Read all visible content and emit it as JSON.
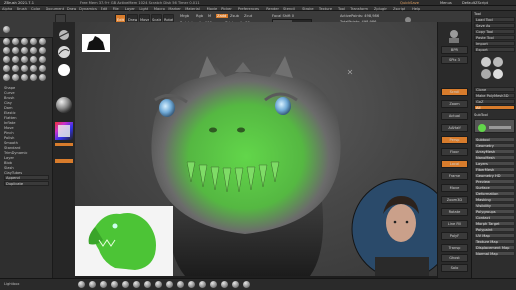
{
  "titlebar": {
    "app_title": "ZBrush 2021.7.1",
    "status_text": "Free Mem 37.9+ GB  ActiveMem 1024  Scratch Disk 56  Timer 0.011",
    "quick_save": "QuickSave",
    "menus_label": "Menus",
    "script_label": "DefaultZScript"
  },
  "menubar": {
    "items": [
      "Alpha",
      "Brush",
      "Color",
      "Document",
      "Draw",
      "Dynamics",
      "Edit",
      "File",
      "Layer",
      "Light",
      "Macro",
      "Marker",
      "Material",
      "Movie",
      "Picker",
      "Preferences",
      "Render",
      "Stencil",
      "Stroke",
      "Texture",
      "Tool",
      "Transform",
      "Zplugin",
      "Zscript",
      "Help"
    ]
  },
  "topshelf": {
    "buttons": [
      "Edit",
      "Draw",
      "Move",
      "Scale",
      "Rotate"
    ],
    "tabs": [
      "Gizmo 3D",
      "Sculpt Mode"
    ],
    "mrgb": "Mrgb",
    "rgb": "Rgb",
    "m": "M",
    "zadd": "Zadd",
    "zsub": "Zsub",
    "zcut": "Zcut",
    "focal_shift_label": "Focal Shift",
    "focal_shift_value": "0",
    "draw_size_label": "Draw Size",
    "draw_size_value": "64",
    "dynamic": "Dynamic",
    "z_intensity_label": "Z Intensity",
    "z_intensity_value": "25",
    "rgb_intensity_label": "Rgb Intensity",
    "rgb_intensity_value": "100",
    "active_points": "ActivePoints: 498,986",
    "total_points": "TotalPoints: 498,986"
  },
  "lefttray": {
    "list": [
      "Shape",
      "Curve",
      "Brush",
      "Clay",
      "Dam",
      "Elastic",
      "Flatten",
      "Inflate",
      "Move",
      "Pinch",
      "Polish",
      "Smooth",
      "Standard",
      "TrimDynamic",
      "Layer",
      "Blob",
      "Slash",
      "ClayTubes",
      "ClayBuildup"
    ],
    "buttons": [
      "Append",
      "Duplicate"
    ]
  },
  "righttray": {
    "header": "Tool",
    "rows": [
      "Load Tool",
      "Save As",
      "Copy Tool",
      "Paste Tool",
      "Import",
      "Export",
      "Clone",
      "Make PolyMesh3D",
      "GoZ",
      "All",
      "Visible",
      "R",
      "Lightbox > Tools"
    ],
    "subtool_header": "SubTool",
    "sections": [
      "Subtool",
      "Geometry",
      "ArrayMesh",
      "NanoMesh",
      "Layers",
      "FiberMesh",
      "Geometry HD",
      "Preview",
      "Surface",
      "Deformation",
      "Masking",
      "Visibility",
      "Polygroups",
      "Contact",
      "Morph Target",
      "Polypaint",
      "UV Map",
      "Texture Map",
      "Displacement Map",
      "Normal Map"
    ]
  },
  "rightshelf": {
    "buttons": [
      "BPR",
      "SPix 3",
      "Scroll",
      "Zoom",
      "Actual",
      "AAHalf",
      "Persp",
      "Floor",
      "Local",
      "Frame",
      "Move",
      "Zoom3D",
      "Rotate",
      "Line Fill",
      "PolyF",
      "Transp",
      "Ghost",
      "Solo",
      "Xpose"
    ]
  },
  "bottomshelf": {
    "brushes": [
      "Standard",
      "ClayBuildup",
      "Move",
      "DamStandard",
      "hPolish",
      "Inflate",
      "Pinch",
      "TrimDynamic",
      "CurveTube",
      "SnakeHook",
      "Clay",
      "Slash3",
      "Smooth",
      "Layer",
      "MaskPen",
      "SelectRect"
    ],
    "label": "Lightbox"
  },
  "colors": {
    "accent": "#d87c2c",
    "model_green": "#62d64a",
    "model_gray": "#8a8a8a"
  }
}
